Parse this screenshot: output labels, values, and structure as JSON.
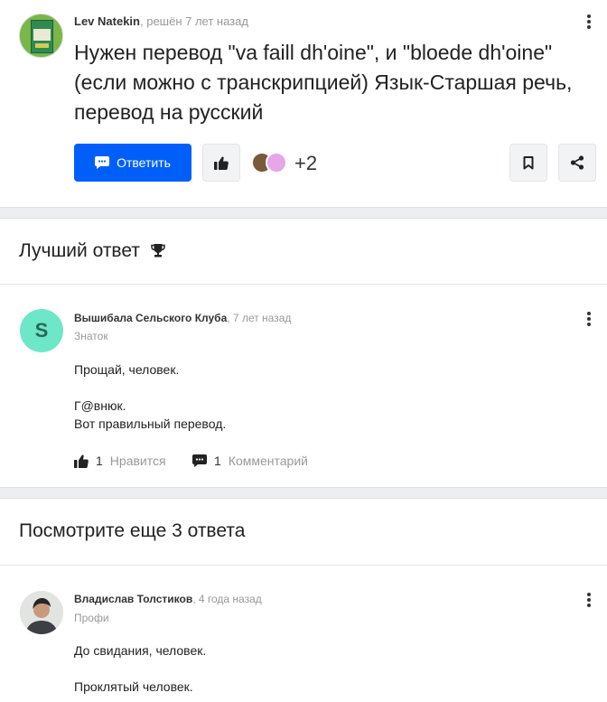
{
  "question": {
    "author": "Lev Natekin",
    "meta": ", решён 7 лет назад",
    "title": "Нужен перевод \"va faill dh'oine\", и \"bloede dh'oine\" (если можно с транскрипцией) Язык-Старшая речь, перевод на русский",
    "answer_button": "Ответить",
    "participants_extra": "+2"
  },
  "best_answer": {
    "heading": "Лучший ответ",
    "author": "Вышибала Сельского Клуба",
    "time": ", 7 лет назад",
    "rank": "Знаток",
    "avatar_letter": "S",
    "lines": [
      "Прощай, человек.",
      "Г@внюк.",
      "Вот правильный перевод."
    ],
    "likes_count": "1",
    "likes_label": "Нравится",
    "comments_count": "1",
    "comments_label": "Комментарий"
  },
  "more_answers": {
    "heading": "Посмотрите еще 3 ответа",
    "answer": {
      "author": "Владислав Толстиков",
      "time": ", 4 года назад",
      "rank": "Профи",
      "lines": [
        "До свидания, человек.",
        "Проклятый человек."
      ]
    }
  },
  "colors": {
    "accent": "#005ff9",
    "avatar_teal": "#6ee6c8",
    "divider": "#eceef2"
  },
  "icons": [
    "kebab-menu-icon",
    "chat-bubble-icon",
    "thumbs-up-icon",
    "bookmark-icon",
    "share-icon",
    "trophy-icon",
    "comment-icon"
  ]
}
